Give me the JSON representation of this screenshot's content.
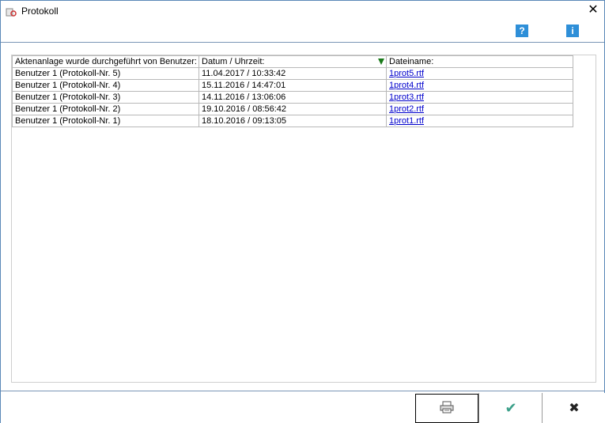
{
  "window": {
    "title": "Protokoll"
  },
  "icons": {
    "app": "protocol-app-icon",
    "close": "close-icon",
    "help": "help-icon",
    "info": "info-icon",
    "print": "printer-icon",
    "ok": "checkmark-icon",
    "cancel": "cancel-x-icon"
  },
  "toolbar": {
    "help_glyph": "?",
    "info_glyph": "i"
  },
  "table": {
    "columns": [
      "Aktenanlage wurde durchgeführt von Benutzer:",
      "Datum / Uhrzeit:",
      "Dateiname:"
    ],
    "sorted_column": "Datum / Uhrzeit:",
    "rows": [
      {
        "user": "Benutzer 1 (Protokoll-Nr. 5)",
        "datetime": "11.04.2017 / 10:33:42",
        "file": "1prot5.rtf"
      },
      {
        "user": "Benutzer 1 (Protokoll-Nr. 4)",
        "datetime": "15.11.2016 / 14:47:01",
        "file": "1prot4.rtf"
      },
      {
        "user": "Benutzer 1 (Protokoll-Nr. 3)",
        "datetime": "14.11.2016 / 13:06:06",
        "file": "1prot3.rtf"
      },
      {
        "user": "Benutzer 1 (Protokoll-Nr. 2)",
        "datetime": "19.10.2016 / 08:56:42",
        "file": "1prot2.rtf"
      },
      {
        "user": "Benutzer 1 (Protokoll-Nr. 1)",
        "datetime": "18.10.2016 / 09:13:05",
        "file": "1prot1.rtf"
      }
    ]
  },
  "colors": {
    "accent": "#2e8fd8",
    "sort_arrow": "#1a7a1a",
    "ok": "#3ca08a",
    "link": "#0000cc"
  }
}
